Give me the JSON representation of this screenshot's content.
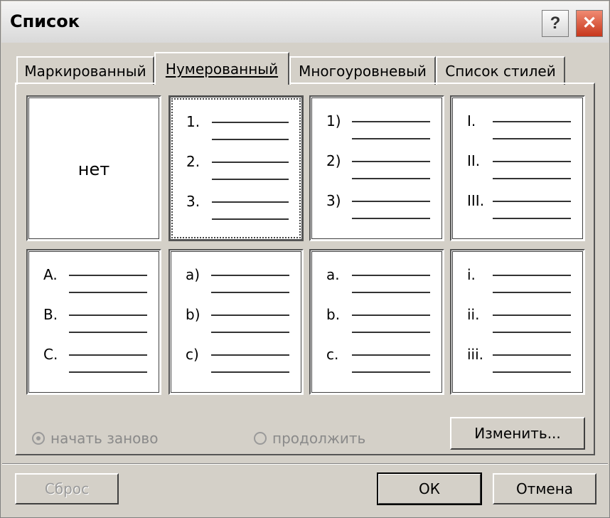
{
  "window": {
    "title": "Список"
  },
  "titlebar": {
    "help_glyph": "?",
    "close_glyph": "✕"
  },
  "tabs": [
    {
      "label": "Маркированный",
      "active": false
    },
    {
      "label": "Нумерованный",
      "active": true
    },
    {
      "label": "Многоуровневый",
      "active": false
    },
    {
      "label": "Список стилей",
      "active": false
    }
  ],
  "gallery": {
    "none_label": "нет",
    "styles": [
      {
        "markers": [
          "1.",
          "2.",
          "3."
        ],
        "selected": true
      },
      {
        "markers": [
          "1)",
          "2)",
          "3)"
        ],
        "selected": false
      },
      {
        "markers": [
          "I.",
          "II.",
          "III."
        ],
        "selected": false
      },
      {
        "markers": [
          "A.",
          "B.",
          "C."
        ],
        "selected": false
      },
      {
        "markers": [
          "a)",
          "b)",
          "c)"
        ],
        "selected": false
      },
      {
        "markers": [
          "a.",
          "b.",
          "c."
        ],
        "selected": false
      },
      {
        "markers": [
          "i.",
          "ii.",
          "iii."
        ],
        "selected": false
      }
    ]
  },
  "options": {
    "restart_label": "начать заново",
    "restart_checked": true,
    "continue_label": "продолжить",
    "continue_checked": false
  },
  "buttons": {
    "modify": "Изменить...",
    "reset": "Сброс",
    "ok": "ОК",
    "cancel": "Отмена"
  }
}
